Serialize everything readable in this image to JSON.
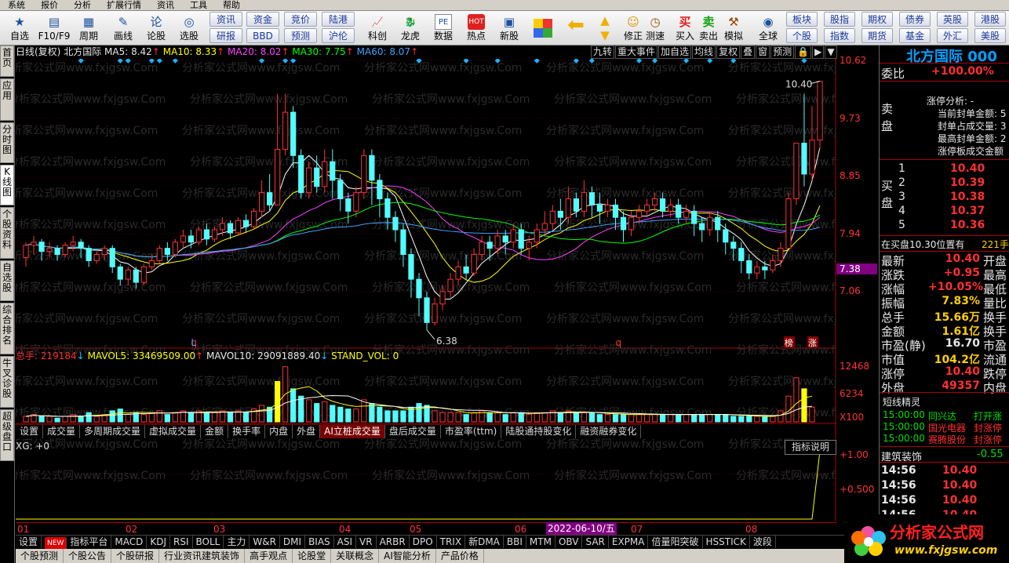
{
  "topbar": {
    "items": [
      "系统",
      "报价",
      "分析",
      "扩展行情",
      "资讯",
      "工具",
      "帮助"
    ]
  },
  "toolbar": {
    "big": [
      {
        "label": "自选",
        "icon": "★"
      },
      {
        "label": "F10/F9",
        "icon": "▤"
      },
      {
        "label": "周期",
        "icon": "▦"
      },
      {
        "label": "画线",
        "icon": "✎"
      },
      {
        "label": "论股",
        "icon": "论"
      },
      {
        "label": "选股",
        "icon": "◎"
      }
    ],
    "pairs": [
      [
        "资讯",
        "研报"
      ],
      [
        "资金",
        "BBD"
      ],
      [
        "竞价",
        "预测"
      ],
      [
        "陆港",
        "沪伦"
      ]
    ],
    "big2": [
      {
        "label": "科创",
        "icon": "📈"
      },
      {
        "label": "龙虎",
        "icon": "🐉"
      },
      {
        "label": "数据",
        "icon": "PE"
      },
      {
        "label": "热点",
        "icon": "HOT"
      },
      {
        "label": "新股",
        "icon": "▣"
      }
    ],
    "big3": [
      {
        "label": "修正",
        "icon": "☺"
      },
      {
        "label": "测速",
        "icon": "◷"
      },
      {
        "label": "买入",
        "icon": "买"
      },
      {
        "label": "卖出",
        "icon": "卖"
      },
      {
        "label": "模拟",
        "icon": "⚒"
      },
      {
        "label": "全球",
        "icon": "◉"
      }
    ],
    "grid": [
      [
        "板块",
        "股指",
        "期权",
        "债券",
        "英股",
        "港股"
      ],
      [
        "个股",
        "指数",
        "期货",
        "基金",
        "外汇",
        "美股"
      ]
    ]
  },
  "sidebar": [
    "首页",
    "应用",
    "分时图",
    "K线图",
    "个股资料",
    "自选股",
    "综合排名",
    "牛叉诊股",
    "超级盘口"
  ],
  "chart_info": {
    "mode": "日线(复权)",
    "name": "北方国际",
    "ma5": "MA5: 8.42",
    "ma10": "MA10: 8.33",
    "ma20": "MA20: 8.02",
    "ma30": "MA30: 7.75",
    "ma60": "MA60: 8.07"
  },
  "chart_buttons": [
    "九转",
    "重大事件",
    "加自选",
    "均线",
    "复权",
    "叠",
    "窗",
    "预测"
  ],
  "price_axis": [
    "10.62",
    "9.73",
    "8.85",
    "7.94",
    "7.06"
  ],
  "price_axis_sel": "7.38",
  "annotations": {
    "high": "10.40",
    "low": "6.38",
    "low_tag": "L",
    "q1": "q",
    "q2": "q",
    "bang": "榜",
    "zhang": "涨"
  },
  "vol_info": {
    "a": "总手: 219184",
    "b": "MAVOL5: 33469509.00",
    "c": "MAVOL10: 29091889.40",
    "d": "STAND_VOL: 0"
  },
  "vol_axis": [
    "12468",
    "6234",
    "X100"
  ],
  "vol_tabs": [
    "设置",
    "成交量",
    "多周期成交量",
    "虚拟成交量",
    "金额",
    "换手率",
    "内盘",
    "外盘",
    "AI立桩成交量",
    "盘后成交量",
    "市盈率(ttm)",
    "陆股通持股变化",
    "融资融券变化"
  ],
  "xg": "XG: +0",
  "index_explain": "指标说明",
  "xg_axis": [
    "+1.00",
    "+0.500"
  ],
  "date_axis": [
    "01",
    "02",
    "03",
    "04",
    "05",
    "06",
    "07",
    "08"
  ],
  "date_highlight": "2022-06-10/五",
  "bottom1": [
    "设置",
    "NEW",
    "指标平台",
    "MACD",
    "KDJ",
    "RSI",
    "BOLL",
    "主力",
    "W&R",
    "DMI",
    "BIAS",
    "ASI",
    "VR",
    "ARBR",
    "DPO",
    "TRIX",
    "新DMA",
    "BBI",
    "MTM",
    "OBV",
    "SAR",
    "EXPMA",
    "倍量阳突破",
    "HSSTICK",
    "波段"
  ],
  "bottom2": [
    "个股预测",
    "个股公告",
    "个股研报",
    "行业资讯建筑装饰",
    "高手观点",
    "论股堂",
    "关联概念",
    "AI智能分析",
    "产品价格"
  ],
  "right": {
    "title": "北方国际 000",
    "weibi_l": "委比",
    "weibi_v": "+100.00%",
    "zt_title": "涨停分析: -",
    "zt_lines": [
      "当前封单金额: 5",
      "封单占成交量: 3",
      "最高封单金额: 2",
      "涨停板成交金额"
    ],
    "sell": "卖盘",
    "buy": "买盘",
    "bids": [
      {
        "n": "1",
        "p": "10.40"
      },
      {
        "n": "2",
        "p": "10.39"
      },
      {
        "n": "3",
        "p": "10.38"
      },
      {
        "n": "4",
        "p": "10.37"
      },
      {
        "n": "5",
        "p": "10.36"
      }
    ],
    "order_l": "在买盘10.30位置有",
    "order_v": "221手",
    "quotes": [
      {
        "l": "最新",
        "v": "10.40",
        "r": "开盘",
        "c": "red"
      },
      {
        "l": "涨跌",
        "v": "+0.95",
        "r": "最高",
        "c": "red"
      },
      {
        "l": "涨幅",
        "v": "+10.05%",
        "r": "最低",
        "c": "red"
      },
      {
        "l": "振幅",
        "v": "7.83%",
        "r": "量比",
        "c": "yel"
      },
      {
        "l": "总手",
        "v": "15.66万",
        "r": "换手",
        "c": "yel"
      },
      {
        "l": "金额",
        "v": "1.61亿",
        "r": "换手",
        "c": "yel"
      },
      {
        "l": "市盈(静)",
        "v": "16.70",
        "r": "市盈",
        "c": "wht"
      },
      {
        "l": "市值",
        "v": "104.2亿",
        "r": "流通",
        "c": "yel"
      },
      {
        "l": "涨停",
        "v": "10.40",
        "r": "跌停",
        "c": "red"
      },
      {
        "l": "外盘",
        "v": "49357",
        "r": "内盘",
        "c": "red"
      }
    ],
    "dx_title": "短线精灵",
    "dx": [
      {
        "t": "15:00:00",
        "n": "同兴达",
        "e": "打开涨",
        "c": "grn"
      },
      {
        "t": "15:00:00",
        "n": "国光电器",
        "e": "封涨停",
        "c": "red"
      },
      {
        "t": "15:00:00",
        "n": "赛腾股份",
        "e": "封涨停",
        "c": "red"
      }
    ],
    "sector": "建筑装饰",
    "sector_v": "-0.55",
    "ticks": [
      {
        "t": "14:56",
        "p": "10.40"
      },
      {
        "t": "14:56",
        "p": "10.40"
      },
      {
        "t": "14:56",
        "p": "10.40"
      },
      {
        "t": "14:56",
        "p": "10.40"
      }
    ]
  },
  "logo": {
    "text": "分析家公式网",
    "url": "www.fxjgsw.com"
  },
  "watermark": "分析家公式网www.fxjgsw.Com",
  "chart_data": {
    "type": "candlestick",
    "ylim": [
      6.2,
      10.7
    ],
    "ma": [
      {
        "name": "MA5",
        "value": 8.42,
        "color": "#ffffff"
      },
      {
        "name": "MA10",
        "value": 8.33,
        "color": "#ffff00"
      },
      {
        "name": "MA20",
        "value": 8.02,
        "color": "#ff40ff"
      },
      {
        "name": "MA30",
        "value": 7.75,
        "color": "#00ff00"
      },
      {
        "name": "MA60",
        "value": 8.07,
        "color": "#40a0ff"
      }
    ],
    "candles": [
      [
        7.55,
        7.75,
        7.4,
        7.8
      ],
      [
        7.75,
        7.8,
        7.6,
        7.9
      ],
      [
        7.8,
        7.65,
        7.5,
        7.85
      ],
      [
        7.65,
        7.7,
        7.55,
        7.8
      ],
      [
        7.7,
        7.6,
        7.5,
        7.75
      ],
      [
        7.6,
        7.75,
        7.55,
        7.8
      ],
      [
        7.75,
        7.8,
        7.65,
        7.9
      ],
      [
        7.8,
        7.7,
        7.55,
        7.85
      ],
      [
        7.7,
        7.5,
        7.4,
        7.75
      ],
      [
        7.5,
        7.6,
        7.45,
        7.65
      ],
      [
        7.6,
        7.7,
        7.5,
        7.75
      ],
      [
        7.7,
        7.4,
        7.3,
        7.75
      ],
      [
        7.4,
        7.2,
        7.1,
        7.45
      ],
      [
        7.2,
        7.35,
        7.1,
        7.4
      ],
      [
        7.35,
        7.15,
        7.05,
        7.4
      ],
      [
        7.15,
        7.4,
        7.1,
        7.45
      ],
      [
        7.4,
        7.5,
        7.35,
        7.6
      ],
      [
        7.5,
        7.7,
        7.45,
        7.75
      ],
      [
        7.7,
        7.6,
        7.5,
        7.8
      ],
      [
        7.6,
        7.8,
        7.55,
        7.85
      ],
      [
        7.8,
        7.9,
        7.7,
        8.0
      ],
      [
        7.9,
        7.8,
        7.7,
        8.0
      ],
      [
        7.8,
        8.0,
        7.75,
        8.05
      ],
      [
        8.0,
        7.85,
        7.75,
        8.1
      ],
      [
        7.85,
        8.0,
        7.8,
        8.05
      ],
      [
        8.0,
        8.1,
        7.9,
        8.2
      ],
      [
        8.1,
        7.95,
        7.85,
        8.15
      ],
      [
        7.95,
        8.15,
        7.9,
        8.2
      ],
      [
        8.15,
        8.05,
        7.95,
        8.25
      ],
      [
        8.05,
        8.3,
        8.0,
        8.35
      ],
      [
        8.3,
        8.6,
        8.2,
        8.8
      ],
      [
        8.6,
        8.4,
        8.3,
        8.9
      ],
      [
        8.4,
        9.3,
        8.4,
        10.2
      ],
      [
        9.3,
        9.9,
        9.2,
        10.2
      ],
      [
        9.9,
        9.2,
        9.0,
        10.0
      ],
      [
        9.2,
        8.6,
        8.5,
        9.3
      ],
      [
        8.6,
        9.0,
        8.5,
        9.1
      ],
      [
        9.0,
        8.7,
        8.6,
        9.2
      ],
      [
        8.7,
        9.1,
        8.6,
        9.3
      ],
      [
        9.1,
        8.8,
        8.5,
        9.3
      ],
      [
        8.8,
        8.5,
        8.3,
        8.9
      ],
      [
        8.5,
        8.3,
        8.1,
        8.6
      ],
      [
        8.3,
        8.6,
        8.2,
        8.7
      ],
      [
        8.6,
        9.2,
        8.5,
        9.3
      ],
      [
        9.2,
        8.8,
        8.4,
        9.3
      ],
      [
        8.8,
        8.5,
        8.2,
        8.9
      ],
      [
        8.5,
        8.2,
        8.0,
        8.6
      ],
      [
        8.2,
        8.0,
        7.8,
        8.3
      ],
      [
        8.0,
        7.6,
        7.4,
        8.1
      ],
      [
        7.6,
        7.2,
        6.9,
        7.7
      ],
      [
        7.2,
        6.9,
        6.6,
        7.3
      ],
      [
        6.9,
        6.5,
        6.38,
        7.0
      ],
      [
        6.5,
        6.8,
        6.45,
        6.9
      ],
      [
        6.8,
        7.0,
        6.7,
        7.1
      ],
      [
        7.0,
        7.2,
        6.9,
        7.3
      ],
      [
        7.2,
        7.4,
        7.1,
        7.5
      ],
      [
        7.4,
        7.3,
        7.2,
        7.6
      ],
      [
        7.3,
        7.6,
        7.25,
        7.7
      ],
      [
        7.6,
        7.8,
        7.5,
        7.9
      ],
      [
        7.8,
        7.7,
        7.5,
        7.9
      ],
      [
        7.7,
        7.9,
        7.6,
        8.0
      ],
      [
        7.9,
        7.8,
        7.6,
        8.0
      ],
      [
        7.8,
        8.0,
        7.7,
        8.1
      ],
      [
        8.0,
        7.7,
        7.6,
        8.1
      ],
      [
        7.7,
        7.8,
        7.5,
        7.9
      ],
      [
        7.8,
        8.0,
        7.7,
        8.1
      ],
      [
        8.0,
        8.1,
        7.9,
        8.3
      ],
      [
        8.1,
        8.3,
        8.0,
        8.4
      ],
      [
        8.3,
        8.2,
        8.0,
        8.5
      ],
      [
        8.2,
        8.5,
        8.1,
        8.7
      ],
      [
        8.5,
        8.3,
        8.2,
        8.6
      ],
      [
        8.3,
        8.6,
        8.2,
        8.8
      ],
      [
        8.6,
        8.4,
        8.2,
        8.7
      ],
      [
        8.4,
        8.3,
        8.1,
        8.6
      ],
      [
        8.3,
        8.4,
        8.2,
        8.5
      ],
      [
        8.4,
        8.2,
        8.0,
        8.5
      ],
      [
        8.2,
        8.0,
        7.8,
        8.3
      ],
      [
        8.0,
        8.2,
        7.9,
        8.3
      ],
      [
        8.2,
        8.3,
        8.1,
        8.4
      ],
      [
        8.3,
        8.4,
        8.2,
        8.5
      ],
      [
        8.4,
        8.5,
        8.3,
        8.6
      ],
      [
        8.5,
        8.3,
        8.2,
        8.6
      ],
      [
        8.3,
        8.4,
        8.2,
        8.5
      ],
      [
        8.4,
        8.2,
        8.1,
        8.5
      ],
      [
        8.2,
        8.3,
        8.1,
        8.4
      ],
      [
        8.3,
        8.1,
        7.9,
        8.4
      ],
      [
        8.1,
        8.0,
        7.8,
        8.2
      ],
      [
        8.0,
        8.2,
        7.9,
        8.3
      ],
      [
        8.2,
        8.0,
        7.8,
        8.3
      ],
      [
        8.0,
        7.8,
        7.6,
        8.1
      ],
      [
        7.8,
        7.7,
        7.5,
        7.9
      ],
      [
        7.7,
        7.5,
        7.3,
        7.8
      ],
      [
        7.5,
        7.3,
        7.2,
        7.6
      ],
      [
        7.3,
        7.4,
        7.2,
        7.5
      ],
      [
        7.4,
        7.35,
        7.2,
        7.5
      ],
      [
        7.35,
        7.5,
        7.3,
        7.6
      ],
      [
        7.5,
        7.7,
        7.4,
        7.8
      ],
      [
        7.7,
        8.5,
        7.7,
        8.6
      ],
      [
        8.5,
        9.4,
        8.4,
        9.4
      ],
      [
        9.4,
        8.9,
        8.7,
        10.2
      ],
      [
        8.9,
        9.45,
        8.8,
        10.0
      ],
      [
        9.45,
        10.4,
        9.3,
        10.4
      ]
    ],
    "volumes": [
      3,
      4,
      3,
      3,
      2,
      3,
      4,
      3,
      5,
      3,
      4,
      6,
      7,
      4,
      5,
      4,
      5,
      6,
      4,
      5,
      6,
      5,
      6,
      5,
      5,
      6,
      5,
      6,
      5,
      7,
      9,
      8,
      22,
      30,
      18,
      14,
      12,
      10,
      11,
      9,
      8,
      7,
      7,
      12,
      10,
      8,
      6,
      6,
      6,
      8,
      10,
      9,
      6,
      5,
      5,
      5,
      4,
      5,
      6,
      5,
      5,
      4,
      5,
      5,
      4,
      5,
      5,
      6,
      5,
      6,
      5,
      5,
      5,
      4,
      4,
      4,
      4,
      4,
      4,
      4,
      4,
      4,
      4,
      4,
      4,
      4,
      4,
      4,
      4,
      4,
      3,
      3,
      3,
      3,
      3,
      3,
      6,
      14,
      24,
      18,
      8
    ],
    "markers": [
      {
        "x": 1,
        "label": "q"
      },
      {
        "x": 21,
        "label": "L"
      },
      {
        "x": 47,
        "label": "q"
      },
      {
        "x": 97,
        "label": "榜"
      },
      {
        "x": 100,
        "label": "涨"
      }
    ]
  }
}
